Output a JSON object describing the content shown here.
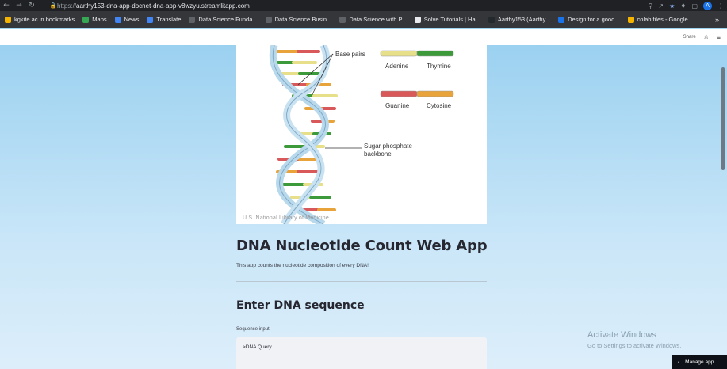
{
  "browser": {
    "url_scheme": "https://",
    "url_host": "aarthy153-dna-app-docnet-dna-app-v8wzyu.streamlitapp.com",
    "profile_initial": "A"
  },
  "bookmarks": [
    {
      "label": "kgkite.ac.in bookmarks",
      "color": "#f4b400"
    },
    {
      "label": "Maps",
      "color": "#34a853"
    },
    {
      "label": "News",
      "color": "#4285f4"
    },
    {
      "label": "Translate",
      "color": "#4285f4"
    },
    {
      "label": "Data Science Funda...",
      "color": "#5f6368"
    },
    {
      "label": "Data Science Busin...",
      "color": "#5f6368"
    },
    {
      "label": "Data Science with P...",
      "color": "#5f6368"
    },
    {
      "label": "Solve Tutorials | Ha...",
      "color": "#e8eaed"
    },
    {
      "label": "Aarthy153 (Aarthy...",
      "color": "#24292e"
    },
    {
      "label": "Design for a good...",
      "color": "#1a73e8"
    },
    {
      "label": "colab files - Google...",
      "color": "#f4b400"
    }
  ],
  "st_header": {
    "share_label": "Share"
  },
  "image": {
    "label_base_pairs": "Base pairs",
    "label_adenine": "Adenine",
    "label_thymine": "Thymine",
    "label_guanine": "Guanine",
    "label_cytosine": "Cytosine",
    "label_sugar_1": "Sugar phosphate",
    "label_sugar_2": "backbone",
    "credit": "U.S. National Library of Medicine",
    "colors": {
      "adenine": "#e8df8a",
      "thymine": "#3d9a3a",
      "guanine": "#d9595a",
      "cytosine": "#e8a43a",
      "backbone": "#b8d8ec"
    }
  },
  "main": {
    "title": "DNA Nucleotide Count Web App",
    "subtitle": "This app counts the nucleotide composition of every DNA!",
    "section_heading": "Enter DNA sequence",
    "input_label": "Sequence input",
    "input_value": ">DNA Query"
  },
  "watermark": {
    "line1": "Activate Windows",
    "line2": "Go to Settings to activate Windows."
  },
  "manage_app": {
    "label": "Manage app"
  }
}
